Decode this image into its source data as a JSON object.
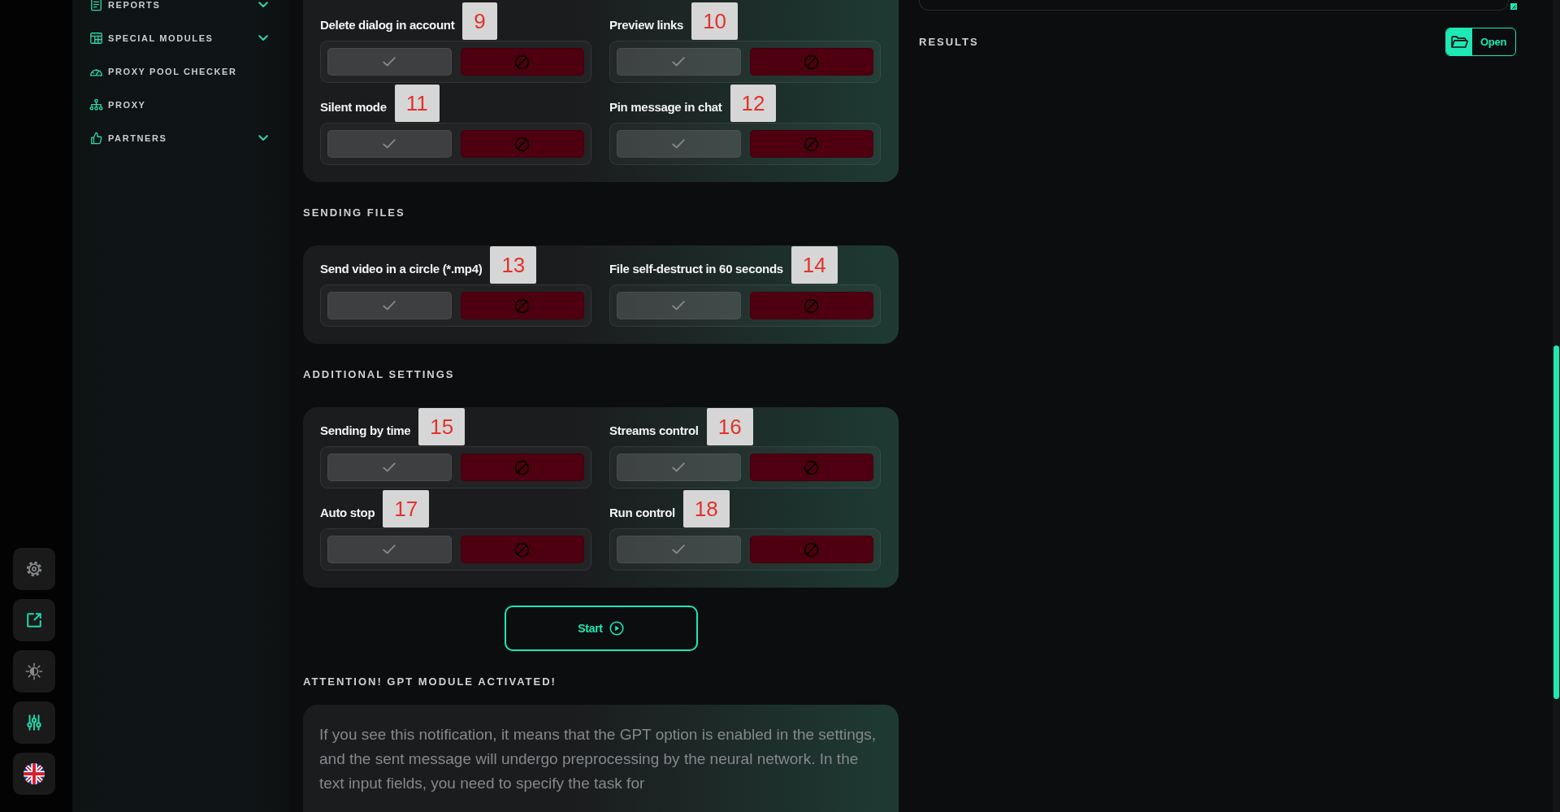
{
  "sidebar": {
    "items": [
      {
        "label": "REPORTS",
        "kind": "group"
      },
      {
        "label": "SPECIAL MODULES",
        "kind": "group"
      },
      {
        "label": "PROXY POOL CHECKER",
        "kind": "link"
      },
      {
        "label": "PROXY",
        "kind": "link"
      },
      {
        "label": "PARTNERS",
        "kind": "group"
      }
    ]
  },
  "sections": [
    {
      "items": [
        {
          "label": "Delete dialog in account",
          "marker": "9",
          "enabled": false
        },
        {
          "label": "Preview links",
          "marker": "10",
          "enabled": false
        },
        {
          "label": "Silent mode",
          "marker": "11",
          "enabled": false
        },
        {
          "label": "Pin message in chat",
          "marker": "12",
          "enabled": false
        }
      ]
    },
    {
      "title": "SENDING FILES",
      "items": [
        {
          "label": "Send video in a circle (*.mp4)",
          "marker": "13",
          "enabled": false
        },
        {
          "label": "File self-destruct in 60 seconds",
          "marker": "14",
          "enabled": false
        }
      ]
    },
    {
      "title": "ADDITIONAL SETTINGS",
      "items": [
        {
          "label": "Sending by time",
          "marker": "15",
          "enabled": false
        },
        {
          "label": "Streams control",
          "marker": "16",
          "enabled": false
        },
        {
          "label": "Auto stop",
          "marker": "17",
          "enabled": false
        },
        {
          "label": "Run control",
          "marker": "18",
          "enabled": false
        }
      ]
    }
  ],
  "start_button": {
    "label": "Start"
  },
  "notice": {
    "title": "ATTENTION! GPT MODULE ACTIVATED!",
    "text": "If you see this notification, it means that the GPT option is enabled in the settings, and the sent message will undergo preprocessing by the neural network. In the text input fields, you need to specify the task for"
  },
  "results": {
    "title": "RESULTS",
    "open_button": {
      "label": "Open"
    }
  }
}
